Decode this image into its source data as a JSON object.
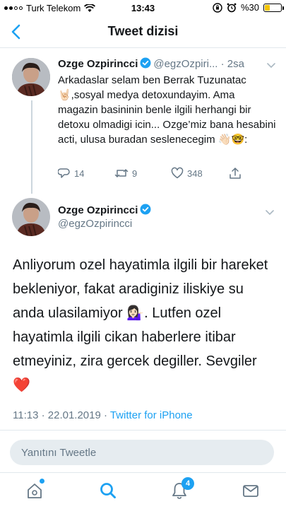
{
  "status_bar": {
    "carrier": "Turk Telekom",
    "time": "13:43",
    "battery": "%30",
    "battery_level": 0.3
  },
  "nav": {
    "title": "Tweet dizisi"
  },
  "tweet1": {
    "name": "Ozge Ozpirincci",
    "handle": "@egzOzpiri...",
    "time": "· 2sa",
    "text": "Arkadaslar selam ben Berrak Tuzunatac 🤘🏻,sosyal medya detoxundayim. Ama magazin basininin benle ilgili herhangi bir detoxu olmadigi icin... Ozge’miz bana hesabini acti, ulusa buradan seslenecegim 👋🏻🤓:",
    "replies": "14",
    "retweets": "9",
    "likes": "348"
  },
  "tweet2": {
    "name": "Ozge Ozpirincci",
    "handle": "@egzOzpirincci",
    "text": "Anliyorum ozel hayatimla ilgili bir hareket bekleniyor, fakat aradiginiz iliskiye su anda ulasilamiyor 💁🏻‍♀️. Lutfen ozel hayatimla ilgili cikan haberlere itibar etmeyiniz, zira gercek degiller. Sevgiler ❤️",
    "date": "11:13 · 22.01.2019 · ",
    "source": "Twitter for iPhone"
  },
  "reply": {
    "placeholder": "Yanıtını Tweetle"
  },
  "tab_bar": {
    "notification_count": "4"
  },
  "colors": {
    "accent": "#1da1f2",
    "text": "#14171a",
    "secondary": "#657786",
    "like_red": "#e0245e"
  }
}
